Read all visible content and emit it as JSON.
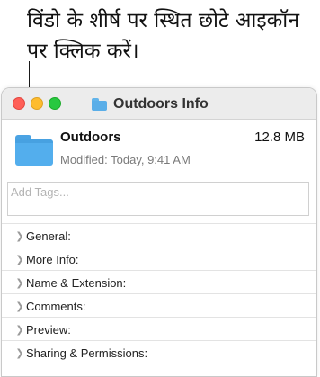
{
  "callout": {
    "text": "विंडो के शीर्ष पर स्थित छोटे आइकॉन पर क्लिक करें।"
  },
  "window": {
    "title": "Outdoors Info",
    "title_icon": "folder-icon",
    "traffic_lights": {
      "close": "#ff5f57",
      "minimize": "#febc2e",
      "zoom": "#28c840"
    }
  },
  "item": {
    "name": "Outdoors",
    "size": "12.8 MB",
    "modified": "Modified: Today, 9:41 AM",
    "icon": "folder-icon",
    "folder_color": "#53aeed"
  },
  "tags": {
    "placeholder": "Add Tags...",
    "value": ""
  },
  "sections": [
    {
      "label": "General:"
    },
    {
      "label": "More Info:"
    },
    {
      "label": "Name & Extension:"
    },
    {
      "label": "Comments:"
    },
    {
      "label": "Preview:"
    },
    {
      "label": "Sharing & Permissions:"
    }
  ]
}
